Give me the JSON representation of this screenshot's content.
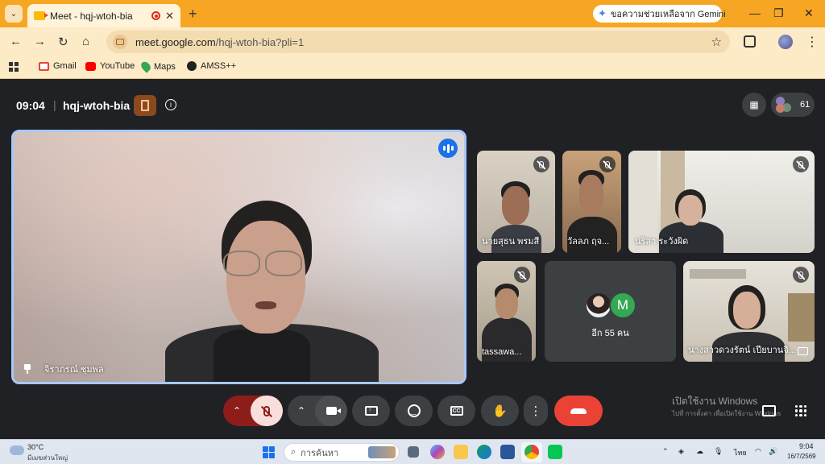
{
  "browser": {
    "tab_title": "Meet - hqj-wtoh-bia",
    "new_tab_symbol": "+",
    "gemini_label": "ขอความช่วยเหลือจาก Gemini",
    "url_host": "meet.google.com",
    "url_path": "/hqj-wtoh-bia?pli=1",
    "bookmarks": [
      {
        "label": "Gmail",
        "color": "#ea4335"
      },
      {
        "label": "YouTube",
        "color": "#ff0000"
      },
      {
        "label": "Maps",
        "color": "#34a853"
      },
      {
        "label": "AMSS++",
        "color": "#222222"
      }
    ]
  },
  "meet": {
    "time": "09:04",
    "separator": "|",
    "meeting_code": "hqj-wtoh-bia",
    "participant_count": "61",
    "main_speaker": "จิราภรณ์ ชุมพล",
    "tiles": [
      {
        "name": "นายสุธน พรมสี",
        "muted": true
      },
      {
        "name": "วัลลภ ฤจ...",
        "muted": true
      },
      {
        "name": "นริสา ระวังผิด",
        "muted": true
      },
      {
        "name": "tassawa...",
        "muted": true
      },
      {
        "name": "นางสาวดวงรัตน์ เปียบานจิ...",
        "muted": true
      }
    ],
    "more_tile": {
      "avatar_letter": "M",
      "label": "อีก 55 คน"
    },
    "colors": {
      "background": "#202124",
      "accent": "#a8c7fa",
      "end_call": "#ea4335",
      "mic_muted": "#8c1d18"
    }
  },
  "controls": {
    "mic_state": "muted",
    "camera_state": "on",
    "icons": [
      "mic-off-icon",
      "camera-icon",
      "present-icon",
      "emoji-icon",
      "captions-icon",
      "raise-hand-icon",
      "more-options-icon",
      "end-call-icon"
    ]
  },
  "windows_watermark": {
    "title": "เปิดใช้งาน Windows",
    "subtitle": "ไปที่ การตั้งค่า เพื่อเปิดใช้งาน Windows"
  },
  "taskbar": {
    "temperature": "30°C",
    "weather_desc": "มีเมฆส่วนใหญ่",
    "search_placeholder": "การค้นหา",
    "language": "ไทย",
    "clock_time": "9:04",
    "clock_date": "16/7/2569"
  }
}
